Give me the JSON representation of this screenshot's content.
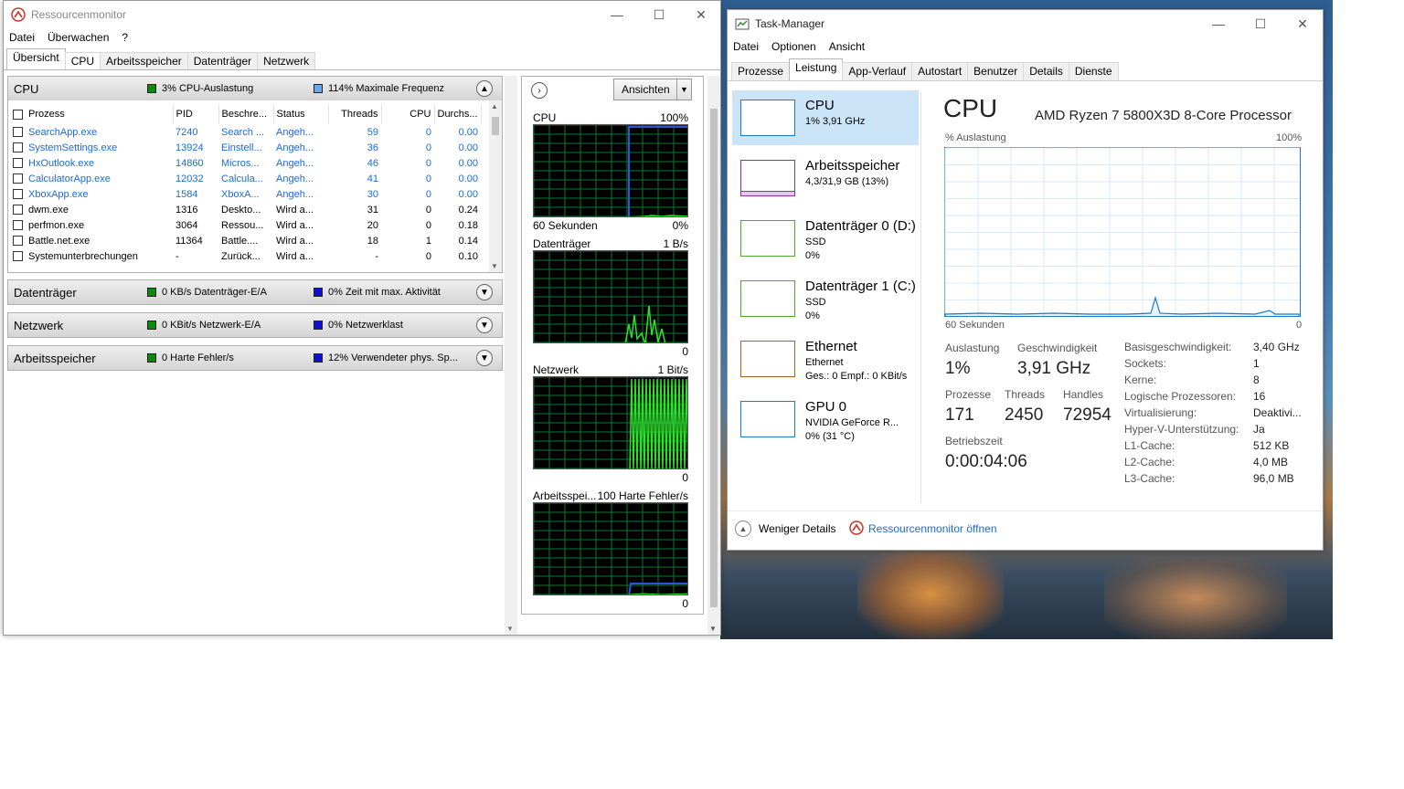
{
  "desktop": {},
  "resmon": {
    "title": "Ressourcenmonitor",
    "menu": [
      "Datei",
      "Überwachen",
      "?"
    ],
    "tabs": [
      "Übersicht",
      "CPU",
      "Arbeitsspeicher",
      "Datenträger",
      "Netzwerk"
    ],
    "cpu": {
      "title": "CPU",
      "ind1": "3% CPU-Auslastung",
      "ind2": "114% Maximale Frequenz",
      "columns": [
        "Prozess",
        "PID",
        "Beschre...",
        "Status",
        "Threads",
        "CPU",
        "Durchs..."
      ],
      "rows": [
        {
          "name": "SearchApp.exe",
          "pid": "7240",
          "desc": "Search ...",
          "status": "Angeh...",
          "threads": "59",
          "cpu": "0",
          "avg": "0.00",
          "blue": true
        },
        {
          "name": "SystemSettings.exe",
          "pid": "13924",
          "desc": "Einstell...",
          "status": "Angeh...",
          "threads": "36",
          "cpu": "0",
          "avg": "0.00",
          "blue": true
        },
        {
          "name": "HxOutlook.exe",
          "pid": "14860",
          "desc": "Micros...",
          "status": "Angeh...",
          "threads": "46",
          "cpu": "0",
          "avg": "0.00",
          "blue": true
        },
        {
          "name": "CalculatorApp.exe",
          "pid": "12032",
          "desc": "Calcula...",
          "status": "Angeh...",
          "threads": "41",
          "cpu": "0",
          "avg": "0.00",
          "blue": true
        },
        {
          "name": "XboxApp.exe",
          "pid": "1584",
          "desc": "XboxA...",
          "status": "Angeh...",
          "threads": "30",
          "cpu": "0",
          "avg": "0.00",
          "blue": true
        },
        {
          "name": "dwm.exe",
          "pid": "1316",
          "desc": "Deskto...",
          "status": "Wird a...",
          "threads": "31",
          "cpu": "0",
          "avg": "0.24",
          "blue": false
        },
        {
          "name": "perfmon.exe",
          "pid": "3064",
          "desc": "Ressou...",
          "status": "Wird a...",
          "threads": "20",
          "cpu": "0",
          "avg": "0.18",
          "blue": false
        },
        {
          "name": "Battle.net.exe",
          "pid": "11364",
          "desc": "Battle....",
          "status": "Wird a...",
          "threads": "18",
          "cpu": "1",
          "avg": "0.14",
          "blue": false
        },
        {
          "name": "Systemunterbrechungen",
          "pid": "-",
          "desc": "Zurück...",
          "status": "Wird a...",
          "threads": "-",
          "cpu": "0",
          "avg": "0.10",
          "blue": false
        }
      ]
    },
    "disk": {
      "title": "Datenträger",
      "ind1": "0 KB/s Datenträger-E/A",
      "ind2": "0% Zeit mit max. Aktivität"
    },
    "net": {
      "title": "Netzwerk",
      "ind1": "0 KBit/s Netzwerk-E/A",
      "ind2": "0% Netzwerklast"
    },
    "mem": {
      "title": "Arbeitsspeicher",
      "ind1": "0 Harte Fehler/s",
      "ind2": "12% Verwendeter phys. Sp..."
    },
    "views_label": "Ansichten",
    "graphs": [
      {
        "name": "CPU",
        "max": "100%",
        "footer_left": "60 Sekunden",
        "footer_right": "0%"
      },
      {
        "name": "Datenträger",
        "max": "1 B/s",
        "footer_left": "",
        "footer_right": "0"
      },
      {
        "name": "Netzwerk",
        "max": "1 Bit/s",
        "footer_left": "",
        "footer_right": "0"
      },
      {
        "name": "Arbeitsspei...",
        "max": "100 Harte Fehler/s",
        "footer_left": "",
        "footer_right": "0"
      }
    ]
  },
  "taskmgr": {
    "title": "Task-Manager",
    "menu": [
      "Datei",
      "Optionen",
      "Ansicht"
    ],
    "tabs": [
      "Prozesse",
      "Leistung",
      "App-Verlauf",
      "Autostart",
      "Benutzer",
      "Details",
      "Dienste"
    ],
    "sidebar": [
      {
        "title": "CPU",
        "line1": "1% 3,91 GHz",
        "line2": "",
        "color": "#1a7bc9"
      },
      {
        "title": "Arbeitsspeicher",
        "line1": "4,3/31,9 GB (13%)",
        "line2": "",
        "color": "#8b2fa8"
      },
      {
        "title": "Datenträger 0 (D:)",
        "line1": "SSD",
        "line2": "0%",
        "color": "#4da82d"
      },
      {
        "title": "Datenträger 1 (C:)",
        "line1": "SSD",
        "line2": "0%",
        "color": "#4da82d"
      },
      {
        "title": "Ethernet",
        "line1": "Ethernet",
        "line2": "Ges.: 0 Empf.: 0 KBit/s",
        "color": "#a7622a"
      },
      {
        "title": "GPU 0",
        "line1": "NVIDIA GeForce R...",
        "line2": "0% (31 °C)",
        "color": "#1a7bc9"
      }
    ],
    "main": {
      "title": "CPU",
      "model": "AMD Ryzen 7 5800X3D 8-Core Processor",
      "graph_label": "% Auslastung",
      "graph_max": "100%",
      "graph_xleft": "60 Sekunden",
      "graph_xright": "0",
      "stats": {
        "util_label": "Auslastung",
        "util": "1%",
        "speed_label": "Geschwindigkeit",
        "speed": "3,91 GHz",
        "proc_label": "Prozesse",
        "proc": "171",
        "threads_label": "Threads",
        "threads": "2450",
        "handles_label": "Handles",
        "handles": "72954",
        "uptime_label": "Betriebszeit",
        "uptime": "0:00:04:06"
      },
      "specs": [
        {
          "k": "Basisgeschwindigkeit:",
          "v": "3,40 GHz"
        },
        {
          "k": "Sockets:",
          "v": "1"
        },
        {
          "k": "Kerne:",
          "v": "8"
        },
        {
          "k": "Logische Prozessoren:",
          "v": "16"
        },
        {
          "k": "Virtualisierung:",
          "v": "Deaktivi..."
        },
        {
          "k": "Hyper-V-Unterstützung:",
          "v": "Ja"
        },
        {
          "k": "L1-Cache:",
          "v": "512 KB"
        },
        {
          "k": "L2-Cache:",
          "v": "4,0 MB"
        },
        {
          "k": "L3-Cache:",
          "v": "96,0 MB"
        }
      ]
    },
    "footer": {
      "less": "Weniger Details",
      "open": "Ressourcenmonitor öffnen"
    }
  }
}
